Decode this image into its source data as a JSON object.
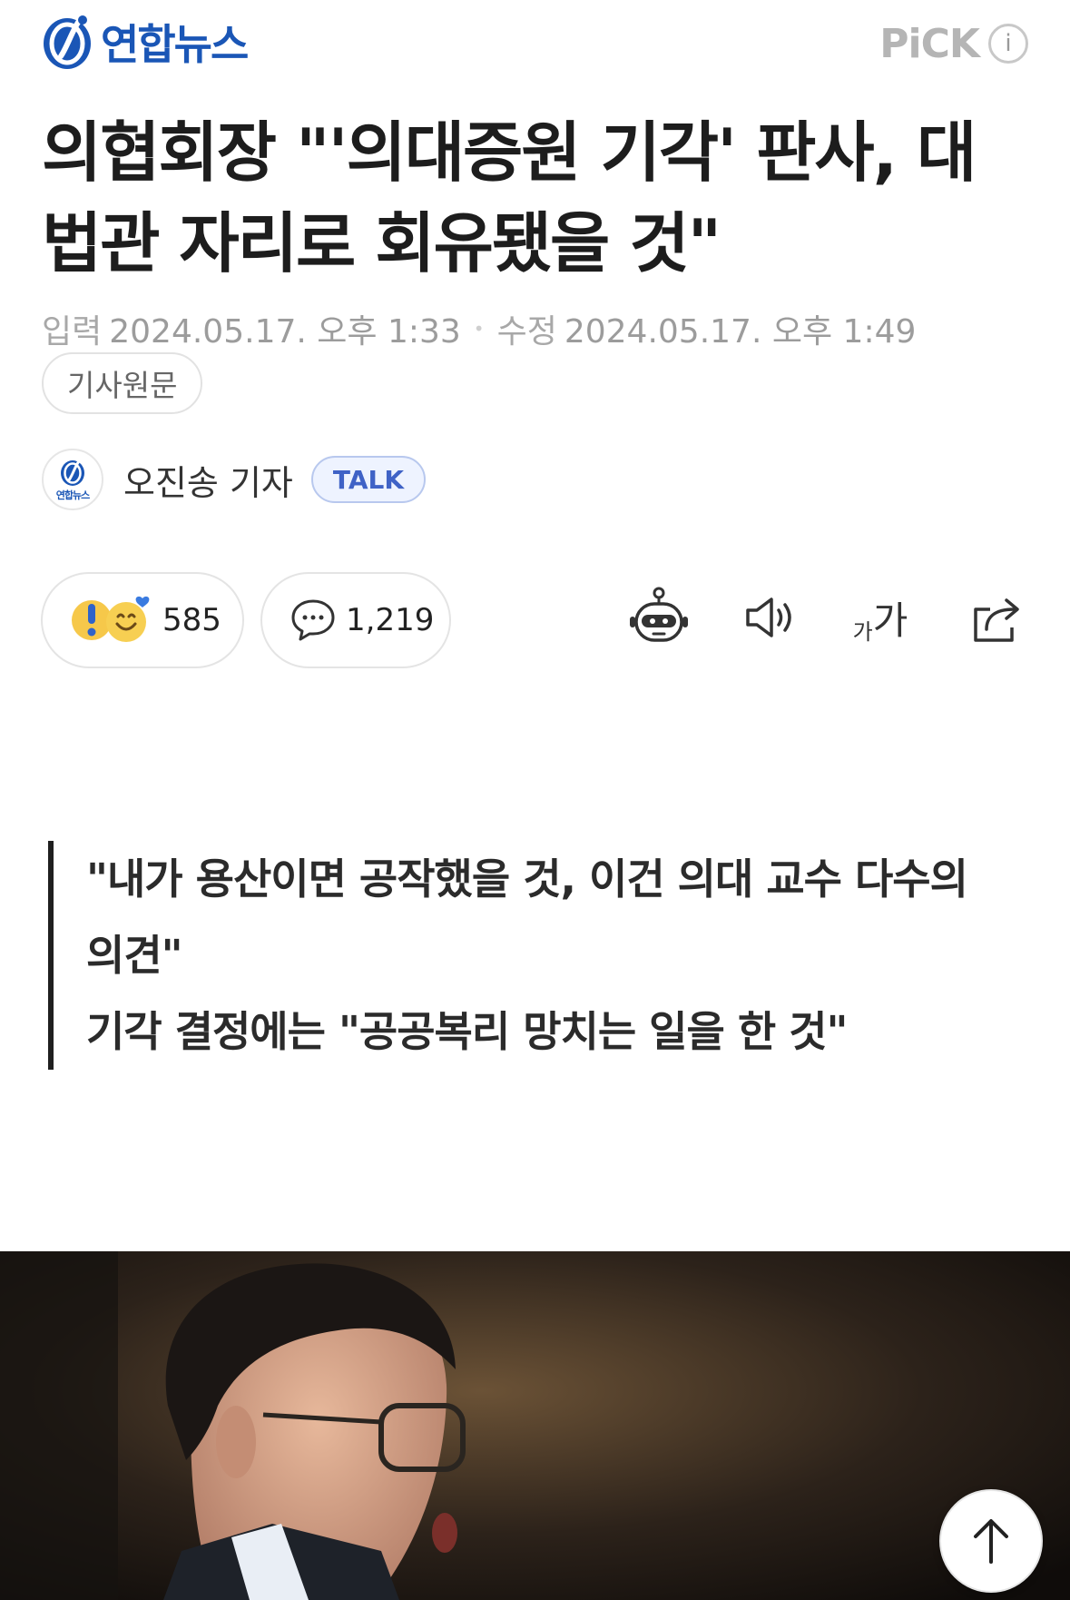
{
  "header": {
    "brand_name": "연합뉴스",
    "pick_label": "PiCK",
    "info_symbol": "i",
    "brand_color": "#1a56b6"
  },
  "article": {
    "title": "의협회장 \"'의대증원 기각' 판사, 대법관 자리로 회유됐을 것\"",
    "input_label": "입력",
    "input_datetime": "2024.05.17. 오후 1:33",
    "separator": "•",
    "modified_label": "수정",
    "modified_datetime": "2024.05.17. 오후 1:49",
    "original_article_label": "기사원문"
  },
  "reporter": {
    "mini_brand": "연합뉴스",
    "name": "오진송 기자",
    "talk_label": "TALK"
  },
  "stats": {
    "reaction_count": "585",
    "comment_count": "1,219"
  },
  "toolbar": {
    "icons": [
      "summary-bot-icon",
      "audio-icon",
      "font-size-icon",
      "share-icon"
    ],
    "font_small": "가",
    "font_large": "가"
  },
  "subtitle": {
    "line1": "\"내가 용산이면 공작했을 것, 이건 의대 교수 다수의 의견\"",
    "line2": "기각 결정에는 \"공공복리 망치는 일을 한 것\""
  },
  "colors": {
    "talk_border": "#b8c8ee",
    "talk_text": "#3f62c6",
    "muted_text": "#9c9c9c"
  }
}
